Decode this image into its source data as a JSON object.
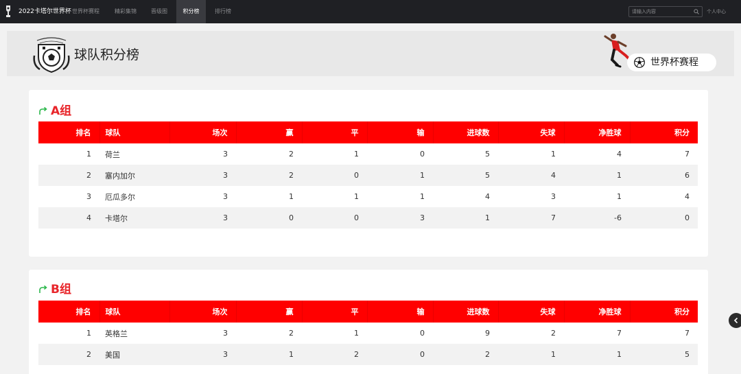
{
  "nav": {
    "site_title": "2022卡塔尔世界杯",
    "items": [
      {
        "label": "世界杯赛程"
      },
      {
        "label": "精彩集锦"
      },
      {
        "label": "晋级图"
      },
      {
        "label": "积分榜"
      },
      {
        "label": "排行榜"
      }
    ],
    "active_index": 3,
    "search_placeholder": "请输入内容",
    "user_center": "个人中心"
  },
  "banner": {
    "title": "球队积分榜",
    "schedule_button": "世界杯赛程"
  },
  "table_headers": [
    "排名",
    "球队",
    "场次",
    "赢",
    "平",
    "输",
    "进球数",
    "失球",
    "净胜球",
    "积分"
  ],
  "groups": [
    {
      "name": "A组",
      "rows": [
        [
          "1",
          "荷兰",
          "3",
          "2",
          "1",
          "0",
          "5",
          "1",
          "4",
          "7"
        ],
        [
          "2",
          "塞内加尔",
          "3",
          "2",
          "0",
          "1",
          "5",
          "4",
          "1",
          "6"
        ],
        [
          "3",
          "厄瓜多尔",
          "3",
          "1",
          "1",
          "1",
          "4",
          "3",
          "1",
          "4"
        ],
        [
          "4",
          "卡塔尔",
          "3",
          "0",
          "0",
          "3",
          "1",
          "7",
          "-6",
          "0"
        ]
      ]
    },
    {
      "name": "B组",
      "rows": [
        [
          "1",
          "英格兰",
          "3",
          "2",
          "1",
          "0",
          "9",
          "2",
          "7",
          "7"
        ],
        [
          "2",
          "美国",
          "3",
          "1",
          "2",
          "0",
          "2",
          "1",
          "1",
          "5"
        ]
      ]
    }
  ],
  "colors": {
    "nav_bg": "#1f2024",
    "header_red": "#ff0000",
    "group_title_red": "#e8252a",
    "arrow_green": "#2db84d"
  },
  "icons": {
    "logo": "trophy-icon",
    "search": "search-icon",
    "club_logo": "club-badge-icon",
    "ball": "soccer-ball-icon",
    "group_arrow": "redo-arrow-icon",
    "side_toggle": "chevron-left-icon"
  }
}
